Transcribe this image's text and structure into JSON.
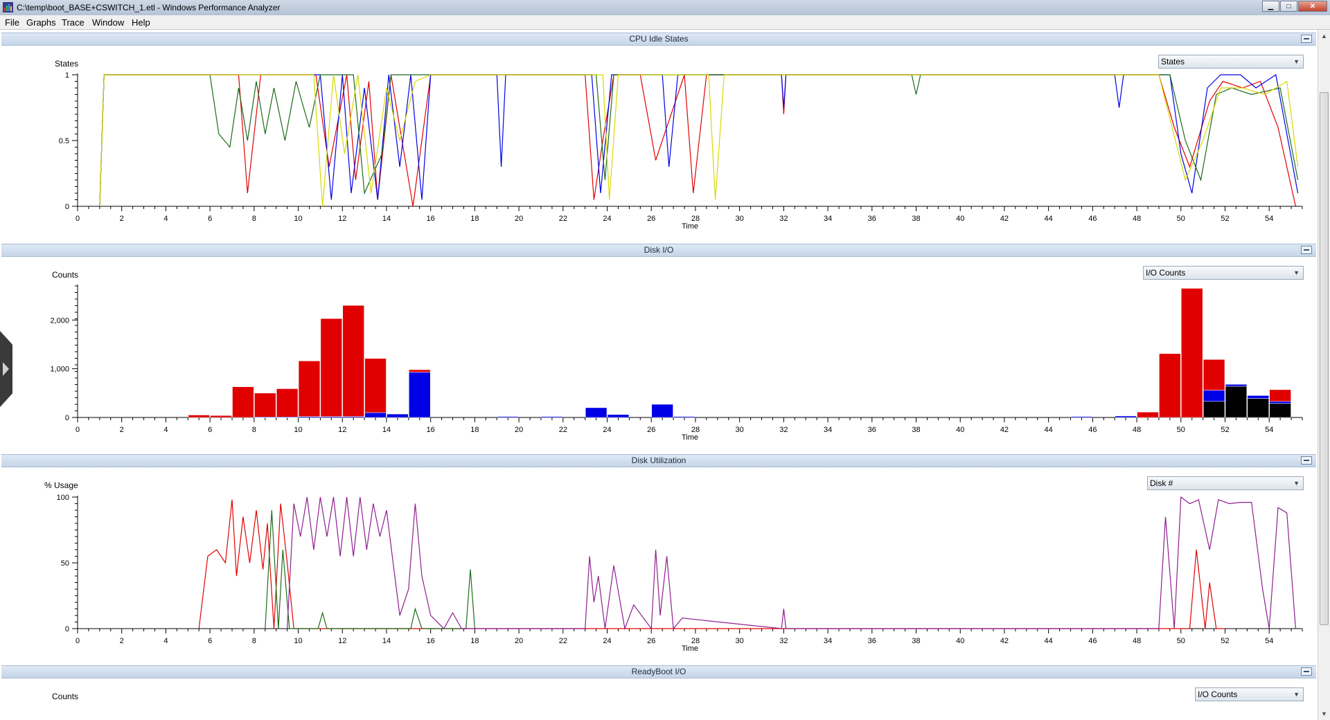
{
  "window": {
    "title": "C:\\temp\\boot_BASE+CSWITCH_1.etl - Windows Performance Analyzer",
    "minimize_icon": "minimize-icon",
    "maximize_icon": "maximize-icon",
    "close_icon": "close-icon"
  },
  "menu": [
    "File",
    "Graphs",
    "Trace",
    "Window",
    "Help"
  ],
  "colors": {
    "red": "#e00000",
    "blue": "#0000e6",
    "green": "#1a6b1a",
    "yellow": "#d8d800",
    "black": "#000000",
    "purple": "#8e1e8e",
    "header": "#c5d5e8"
  },
  "cpu_idle": {
    "title": "CPU Idle States",
    "y_title": "States",
    "dropdown": "States",
    "x_label": "Time",
    "chart_data": {
      "type": "line",
      "xlim": [
        0,
        55.5
      ],
      "ylim": [
        0,
        1
      ],
      "y_ticks": [
        "0",
        "0.5",
        "1"
      ],
      "x_ticks": [
        0,
        2,
        4,
        6,
        8,
        10,
        12,
        14,
        16,
        18,
        20,
        22,
        24,
        26,
        28,
        30,
        32,
        34,
        36,
        38,
        40,
        42,
        44,
        46,
        48,
        50,
        52,
        54
      ],
      "grid": false,
      "series": [
        {
          "color": "#e00000",
          "x": [
            1,
            1.2,
            7.3,
            7.7,
            8.3,
            10.8,
            11.4,
            12.2,
            12.6,
            13.2,
            13.6,
            14.2,
            15.2,
            16,
            23,
            23.4,
            23.8,
            24.3,
            25.5,
            26.2,
            27.5,
            27.9,
            28.5,
            31.9,
            32,
            32.1,
            49,
            49.7,
            50.4,
            51.3,
            51.9,
            52.8,
            53.6,
            54.4,
            55.2
          ],
          "y": [
            0,
            1,
            1,
            0.1,
            1,
            1,
            0.3,
            1,
            0.2,
            0.95,
            0.05,
            1,
            0,
            1,
            1,
            0.05,
            0.5,
            1,
            1,
            0.35,
            1,
            0.1,
            1,
            1,
            0.7,
            1,
            1,
            0.6,
            0.3,
            0.8,
            0.95,
            0.9,
            0.95,
            0.6,
            0
          ]
        },
        {
          "color": "#0000e6",
          "x": [
            1,
            1.2,
            11,
            11.5,
            12,
            12.4,
            13,
            13.6,
            14.1,
            14.6,
            15.1,
            15.6,
            16,
            19,
            19.2,
            19.4,
            23.3,
            23.7,
            24.2,
            26.5,
            26.8,
            27.2,
            31.9,
            32,
            32.1,
            47,
            47.2,
            47.4,
            49.5,
            50,
            50.5,
            51.2,
            51.8,
            52.7,
            53.4,
            54.3,
            55.3
          ],
          "y": [
            0,
            1,
            1,
            0.05,
            1,
            0.1,
            0.9,
            0.05,
            1,
            0.3,
            1,
            0.05,
            1,
            1,
            0.3,
            1,
            1,
            0.1,
            1,
            1,
            0.3,
            1,
            1,
            0.75,
            1,
            1,
            0.75,
            1,
            1,
            0.4,
            0.1,
            0.9,
            1,
            1,
            0.9,
            1,
            0.1
          ]
        },
        {
          "color": "#1a6b1a",
          "x": [
            1,
            1.2,
            6,
            6.4,
            6.9,
            7.3,
            7.7,
            8.1,
            8.5,
            8.9,
            9.4,
            9.9,
            10.5,
            11,
            12.5,
            13,
            13.8,
            14.2,
            23.5,
            23.9,
            24.3,
            37.8,
            38,
            38.2,
            49.5,
            50.2,
            50.9,
            51.6,
            52.3,
            53.2,
            54.5,
            55.3
          ],
          "y": [
            0,
            1,
            1,
            0.55,
            0.45,
            0.9,
            0.5,
            0.95,
            0.55,
            0.9,
            0.5,
            0.95,
            0.6,
            1,
            1,
            0.1,
            0.4,
            1,
            1,
            0.2,
            1,
            1,
            0.85,
            1,
            1,
            0.5,
            0.2,
            0.85,
            0.9,
            0.85,
            0.9,
            0.2
          ]
        },
        {
          "color": "#d8d800",
          "x": [
            1,
            1.2,
            10.7,
            11.1,
            11.6,
            12.1,
            12.7,
            13.3,
            14,
            14.6,
            15.3,
            16,
            23.8,
            24.1,
            24.5,
            28.6,
            28.9,
            29.3,
            49,
            49.6,
            50.2,
            51,
            51.8,
            52.8,
            53.8,
            54.8,
            55.3
          ],
          "y": [
            0,
            1,
            1,
            0,
            1,
            0.4,
            1,
            0.1,
            0.9,
            0.5,
            0.95,
            1,
            1,
            0.05,
            1,
            1,
            0.05,
            1,
            1,
            0.6,
            0.2,
            0.5,
            0.9,
            0.9,
            0.85,
            0.95,
            0.3
          ]
        }
      ]
    }
  },
  "disk_io": {
    "title": "Disk I/O",
    "y_title": "Counts",
    "dropdown": "I/O Counts",
    "x_label": "Time",
    "chart_data": {
      "type": "bar",
      "stacked": true,
      "xlim": [
        0,
        55.5
      ],
      "ylim": [
        0,
        2700
      ],
      "y_ticks": [
        "0",
        "1,000",
        "2,000"
      ],
      "x_ticks": [
        0,
        2,
        4,
        6,
        8,
        10,
        12,
        14,
        16,
        18,
        20,
        22,
        24,
        26,
        28,
        30,
        32,
        34,
        36,
        38,
        40,
        42,
        44,
        46,
        48,
        50,
        52,
        54
      ],
      "bin_width": 1,
      "bins_start": [
        5,
        6,
        7,
        8,
        9,
        10,
        11,
        12,
        13,
        14,
        15,
        19,
        21,
        23,
        24,
        26,
        27,
        45,
        47,
        48,
        49,
        50,
        51,
        52,
        53,
        54
      ],
      "series": [
        {
          "color": "#000000",
          "values": [
            0,
            0,
            0,
            0,
            0,
            0,
            0,
            0,
            0,
            0,
            0,
            0,
            0,
            0,
            0,
            0,
            0,
            0,
            0,
            0,
            0,
            0,
            330,
            640,
            390,
            290
          ]
        },
        {
          "color": "#0000e6",
          "values": [
            0,
            0,
            0,
            10,
            10,
            20,
            20,
            20,
            100,
            70,
            930,
            20,
            20,
            200,
            60,
            270,
            20,
            20,
            30,
            0,
            0,
            0,
            230,
            40,
            60,
            40
          ]
        },
        {
          "color": "#e00000",
          "values": [
            50,
            40,
            630,
            490,
            580,
            1140,
            2010,
            2280,
            1110,
            0,
            50,
            0,
            0,
            0,
            0,
            0,
            0,
            0,
            0,
            110,
            1310,
            2650,
            630,
            0,
            0,
            240
          ]
        }
      ]
    }
  },
  "disk_util": {
    "title": "Disk Utilization",
    "y_title": "% Usage",
    "dropdown": "Disk #",
    "x_label": "Time",
    "chart_data": {
      "type": "line",
      "xlim": [
        0,
        55.5
      ],
      "ylim": [
        0,
        100
      ],
      "y_ticks": [
        "0",
        "50",
        "100"
      ],
      "x_ticks": [
        0,
        2,
        4,
        6,
        8,
        10,
        12,
        14,
        16,
        18,
        20,
        22,
        24,
        26,
        28,
        30,
        32,
        34,
        36,
        38,
        40,
        42,
        44,
        46,
        48,
        50,
        52,
        54
      ],
      "series": [
        {
          "color": "#e00000",
          "x": [
            5.5,
            5.9,
            6.3,
            6.7,
            7.0,
            7.2,
            7.5,
            7.8,
            8.1,
            8.4,
            8.6,
            8.9,
            9.2,
            9.5,
            9.8,
            50.4,
            50.7,
            51.1,
            51.3,
            51.6,
            52
          ],
          "y": [
            0,
            55,
            60,
            50,
            98,
            40,
            85,
            50,
            90,
            45,
            80,
            0,
            95,
            50,
            0,
            0,
            60,
            0,
            35,
            0,
            0
          ]
        },
        {
          "color": "#1a6b1a",
          "x": [
            8.5,
            8.8,
            9.1,
            9.3,
            9.6,
            10.9,
            11.1,
            11.3,
            15.1,
            15.3,
            15.6,
            17.6,
            17.8,
            18.0
          ],
          "y": [
            0,
            90,
            0,
            60,
            0,
            0,
            12,
            0,
            0,
            15,
            0,
            0,
            45,
            0
          ]
        },
        {
          "color": "#8e1e8e",
          "x": [
            9.5,
            9.8,
            10.1,
            10.4,
            10.7,
            11,
            11.3,
            11.6,
            11.9,
            12.2,
            12.5,
            12.8,
            13.1,
            13.4,
            13.7,
            14.0,
            14.3,
            14.6,
            15,
            15.3,
            15.6,
            16,
            16.6,
            17,
            17.4,
            23,
            23.2,
            23.4,
            23.6,
            23.9,
            24.3,
            24.8,
            25.2,
            26,
            26.2,
            26.4,
            26.7,
            27,
            27.4,
            31.9,
            32,
            32.1,
            49,
            49.3,
            49.7,
            50,
            50.4,
            50.8,
            51.3,
            51.7,
            52.2,
            52.7,
            53.2,
            53.7,
            54,
            54.4,
            54.8,
            55.2
          ],
          "y": [
            0,
            95,
            70,
            100,
            60,
            100,
            70,
            100,
            55,
            100,
            55,
            100,
            60,
            95,
            70,
            90,
            50,
            10,
            30,
            95,
            40,
            10,
            0,
            12,
            0,
            0,
            55,
            20,
            40,
            0,
            48,
            0,
            18,
            0,
            60,
            10,
            55,
            0,
            8,
            0,
            15,
            0,
            0,
            85,
            0,
            100,
            95,
            98,
            60,
            98,
            95,
            96,
            96,
            30,
            0,
            92,
            88,
            0
          ]
        }
      ]
    }
  },
  "readyboot": {
    "title": "ReadyBoot I/O",
    "y_title": "Counts",
    "dropdown": "I/O Counts"
  }
}
